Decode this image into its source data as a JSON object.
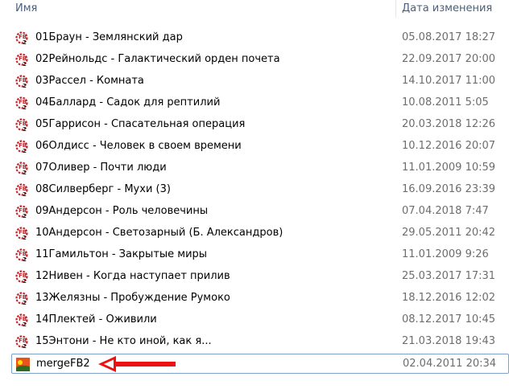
{
  "header": {
    "name": "Имя",
    "date": "Дата изменения"
  },
  "files": [
    {
      "name": "01Браун - Землянский дар",
      "date": "05.08.2017 18:27",
      "icon": "fb2-icon"
    },
    {
      "name": "02Рейнольдс - Галактический орден почета",
      "date": "22.09.2017 20:00",
      "icon": "fb2-icon"
    },
    {
      "name": "03Рассел - Комната",
      "date": "14.10.2017 11:00",
      "icon": "fb2-icon"
    },
    {
      "name": "04Баллард - Садок для рептилий",
      "date": "10.08.2011 5:05",
      "icon": "fb2-icon"
    },
    {
      "name": "05Гаррисон - Спасательная операция",
      "date": "20.03.2018 12:26",
      "icon": "fb2-icon"
    },
    {
      "name": "06Олдисс - Человек в своем времени",
      "date": "10.12.2016 20:07",
      "icon": "fb2-icon"
    },
    {
      "name": "07Оливер - Почти люди",
      "date": "11.01.2009 10:59",
      "icon": "fb2-icon"
    },
    {
      "name": "08Силверберг - Мухи (3)",
      "date": "16.09.2016 23:39",
      "icon": "fb2-icon"
    },
    {
      "name": "09Андерсон - Роль человечины",
      "date": "07.04.2018 7:47",
      "icon": "fb2-icon"
    },
    {
      "name": "10Андерсон - Светозарный (Б. Александров)",
      "date": "29.05.2011 20:42",
      "icon": "fb2-icon"
    },
    {
      "name": "11Гамильтон - Закрытые миры",
      "date": "11.01.2009 9:26",
      "icon": "fb2-icon"
    },
    {
      "name": "12Нивен - Когда наступает прилив",
      "date": "25.03.2017 17:31",
      "icon": "fb2-icon"
    },
    {
      "name": "13Желязны - Пробуждение Румоко",
      "date": "18.12.2016 12:02",
      "icon": "fb2-icon"
    },
    {
      "name": "14Плектей - Оживили",
      "date": "08.12.2017 10:45",
      "icon": "fb2-icon"
    },
    {
      "name": "15Энтони - Не кто иной, как я...",
      "date": "21.03.2018 19:43",
      "icon": "fb2-icon"
    },
    {
      "name": "mergeFB2",
      "date": "02.04.2011 20:34",
      "icon": "image-app-icon",
      "selected": true
    }
  ],
  "colors": {
    "arrow": "#ee1111",
    "selection_border": "#7da2ce"
  }
}
